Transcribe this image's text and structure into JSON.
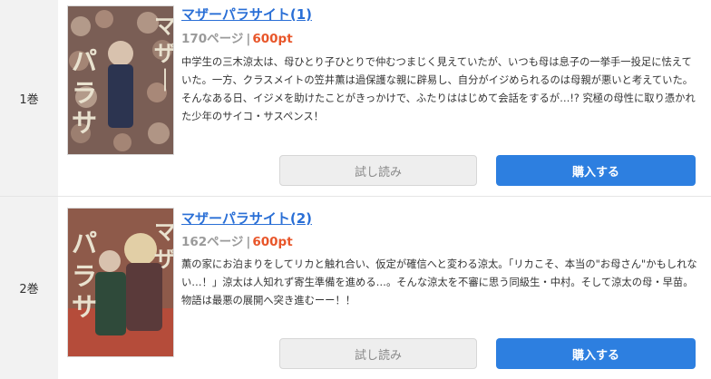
{
  "volumes": [
    {
      "volume_label": "1巻",
      "title": "マザーパラサイト(1)",
      "pages": "170ページ",
      "separator": "|",
      "price": "600pt",
      "description": "中学生の三木涼太は、母ひとり子ひとりで仲むつまじく見えていたが、いつも母は息子の一挙手一投足に怯えていた。一方、クラスメイトの笠井薫は過保護な親に辟易し、自分がイジめられるのは母親が悪いと考えていた。そんなある日、イジメを助けたことがきっかけで、ふたりははじめて会話をするが…!? 究極の母性に取り憑かれた少年のサイコ・サスペンス！",
      "trial_label": "試し読み",
      "buy_label": "購入する"
    },
    {
      "volume_label": "2巻",
      "title": "マザーパラサイト(2)",
      "pages": "162ページ",
      "separator": "|",
      "price": "600pt",
      "description": "薫の家にお泊まりをしてリカと触れ合い、仮定が確信へと変わる涼太。「リカこそ、本当の\"お母さん\"かもしれない…！」涼太は人知れず寄生準備を進める…。そんな涼太を不審に思う同級生・中村。そして涼太の母・早苗。物語は最悪の展開へ突き進むーー！！",
      "trial_label": "試し読み",
      "buy_label": "購入する"
    }
  ],
  "colors": {
    "title": "#2a6fd6",
    "price": "#e8562a",
    "buy_button": "#2d7fe0",
    "volume_column": "#f2f2f2"
  }
}
